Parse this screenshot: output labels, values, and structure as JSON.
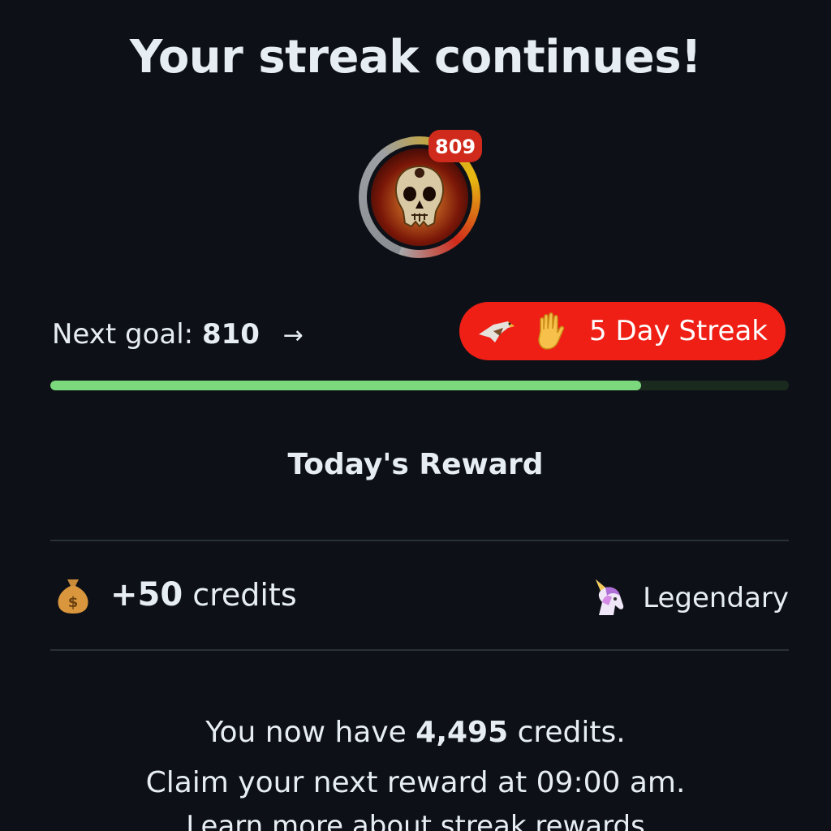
{
  "title": "Your streak continues!",
  "avatar": {
    "score": "809",
    "icon": "flaming-skull-avatar"
  },
  "goal": {
    "label": "Next goal:",
    "value": "810",
    "arrow": "→"
  },
  "streak": {
    "label": "5 Day Streak",
    "icons": [
      "eagle-icon",
      "raised-hand-icon"
    ],
    "color": "#ef1f16"
  },
  "progress": {
    "fraction": 0.8,
    "fill_color": "#7cd87c"
  },
  "reward": {
    "title": "Today's Reward",
    "amount": "+50",
    "unit": "credits",
    "rarity": "Legendary",
    "rarity_icon": "unicorn-icon",
    "amount_icon": "money-bag-icon"
  },
  "summary": {
    "line1_prefix": "You now have",
    "balance": "4,495",
    "line1_suffix": "credits.",
    "line2": "Claim your next reward at 09:00 am."
  },
  "learn_more": "Learn more about streak rewards"
}
